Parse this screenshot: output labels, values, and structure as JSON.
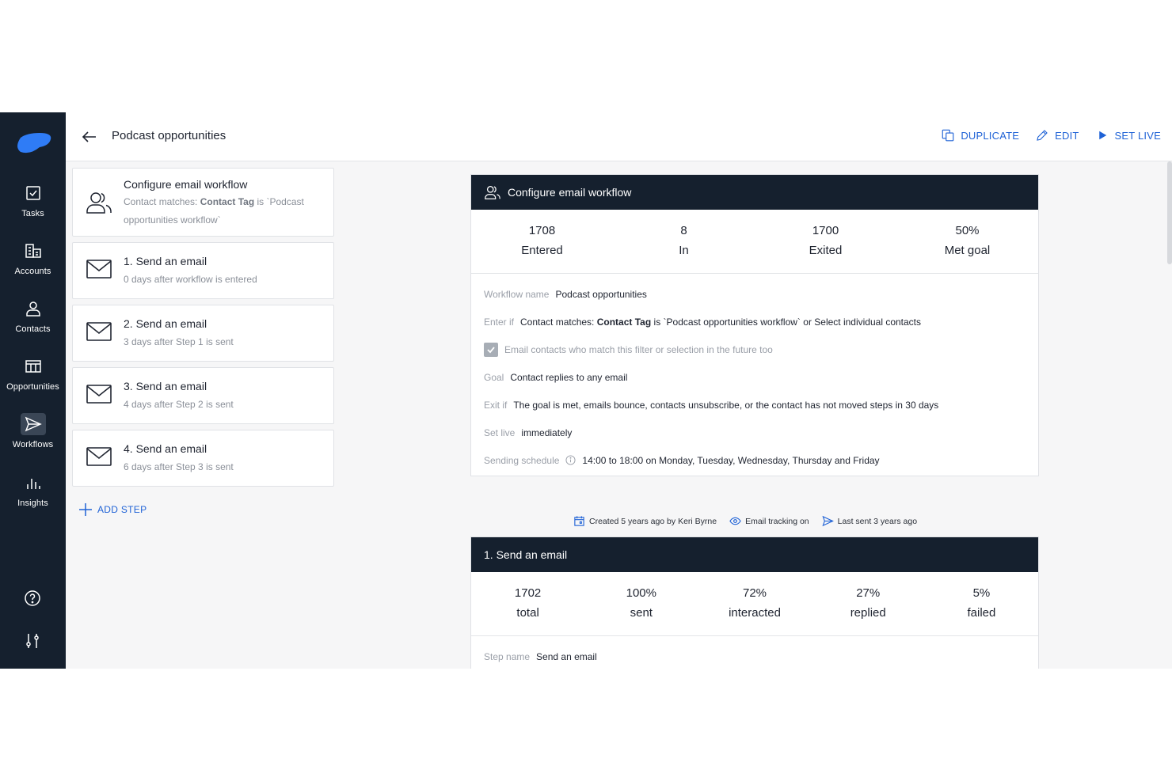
{
  "sidebar": {
    "items": [
      {
        "label": "Tasks",
        "icon": "checkbox-icon"
      },
      {
        "label": "Accounts",
        "icon": "building-icon"
      },
      {
        "label": "Contacts",
        "icon": "person-icon"
      },
      {
        "label": "Opportunities",
        "icon": "table-icon"
      },
      {
        "label": "Workflows",
        "icon": "send-icon"
      },
      {
        "label": "Insights",
        "icon": "bar-chart-icon"
      }
    ],
    "accent": "#15202e"
  },
  "header": {
    "title": "Podcast opportunities",
    "actions": {
      "duplicate": "DUPLICATE",
      "edit": "EDIT",
      "set_live": "SET LIVE"
    },
    "accent": "#1f62d6"
  },
  "steps": [
    {
      "title": "Configure email workflow",
      "sub_prefix": "Contact matches: ",
      "sub_bold": "Contact Tag",
      "sub_suffix": " is `Podcast opportunities workflow`"
    },
    {
      "title": "1. Send an email",
      "sub": "0 days after workflow is entered"
    },
    {
      "title": "2. Send an email",
      "sub": "3 days after Step 1 is sent"
    },
    {
      "title": "3. Send an email",
      "sub": "4 days after Step 2 is sent"
    },
    {
      "title": "4. Send an email",
      "sub": "6 days after Step 3 is sent"
    }
  ],
  "add_step": "ADD STEP",
  "config_card": {
    "title": "Configure email workflow",
    "stats": [
      {
        "value": "1708",
        "label": "Entered"
      },
      {
        "value": "8",
        "label": "In"
      },
      {
        "value": "1700",
        "label": "Exited"
      },
      {
        "value": "50%",
        "label": "Met goal"
      }
    ],
    "workflow_name_label": "Workflow name",
    "workflow_name": "Podcast opportunities",
    "enter_if_label": "Enter if",
    "enter_if_prefix": "Contact matches: ",
    "enter_if_bold": "Contact Tag",
    "enter_if_suffix": " is `Podcast opportunities workflow` or Select individual contacts",
    "future_checkbox": "Email contacts who match this filter or selection in the future too",
    "goal_label": "Goal",
    "goal": "Contact replies to any email",
    "exit_if_label": "Exit if",
    "exit_if": "The goal is met, emails bounce, contacts unsubscribe, or the contact has not moved steps in 30 days",
    "set_live_label": "Set live",
    "set_live": "immediately",
    "schedule_label": "Sending schedule",
    "schedule": "14:00 to 18:00 on Monday, Tuesday, Wednesday, Thursday and Friday"
  },
  "meta": {
    "created": "Created 5 years ago by Keri Byrne",
    "tracking": "Email tracking on",
    "last_sent": "Last sent 3 years ago"
  },
  "email_card": {
    "title": "1. Send an email",
    "stats": [
      {
        "value": "1702",
        "label": "total"
      },
      {
        "value": "100%",
        "label": "sent"
      },
      {
        "value": "72%",
        "label": "interacted"
      },
      {
        "value": "27%",
        "label": "replied"
      },
      {
        "value": "5%",
        "label": "failed"
      }
    ],
    "step_name_label": "Step name",
    "step_name": "Send an email"
  }
}
